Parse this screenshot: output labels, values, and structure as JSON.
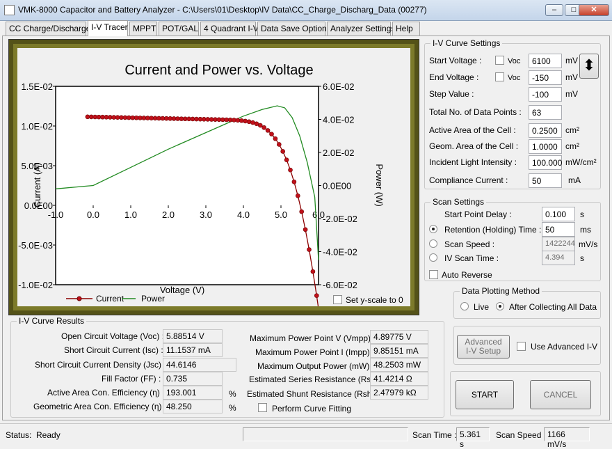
{
  "window": {
    "title": "VMK-8000 Capacitor and Battery Analyzer - C:\\Users\\01\\Desktop\\IV Data\\CC_Charge_Discharg_Data (00277)"
  },
  "tabs": [
    "CC Charge/Discharge",
    "I-V Tracer",
    "MPPT",
    "POT/GAL",
    "4 Quadrant I-V",
    "Data Save Options",
    "Analyzer Settings",
    "Help"
  ],
  "active_tab": "I-V Tracer",
  "chart_data": {
    "type": "line",
    "title": "Current and Power vs. Voltage",
    "xlabel": "Voltage (V)",
    "ylabel": "Current (A)",
    "y2label": "Power (W)",
    "xlim": [
      -1.0,
      6.0
    ],
    "ylim": [
      -0.01,
      0.015
    ],
    "y2lim": [
      -0.06,
      0.06
    ],
    "x_ticks": [
      "-1.0",
      "0.0",
      "1.0",
      "2.0",
      "3.0",
      "4.0",
      "5.0",
      "6.0"
    ],
    "y_ticks": [
      "1.5E-02",
      "1.0E-02",
      "5.0E-03",
      "0.0E00",
      "-5.0E-03",
      "-1.0E-02"
    ],
    "y2_ticks": [
      "6.0E-02",
      "4.0E-02",
      "2.0E-02",
      "0.0E00",
      "-2.0E-02",
      "-4.0E-02",
      "-6.0E-02"
    ],
    "series": [
      {
        "name": "Current",
        "color": "#8b0000",
        "marker_color": "#c0101a",
        "x": [
          -0.15,
          -0.05,
          0.05,
          0.15,
          0.25,
          0.35,
          0.45,
          0.55,
          0.65,
          0.75,
          0.85,
          0.95,
          1.05,
          1.15,
          1.25,
          1.35,
          1.45,
          1.55,
          1.65,
          1.75,
          1.85,
          1.95,
          2.05,
          2.15,
          2.25,
          2.35,
          2.45,
          2.55,
          2.65,
          2.75,
          2.85,
          2.95,
          3.05,
          3.15,
          3.25,
          3.35,
          3.45,
          3.55,
          3.65,
          3.75,
          3.85,
          3.95,
          4.05,
          4.15,
          4.25,
          4.35,
          4.45,
          4.55,
          4.65,
          4.75,
          4.85,
          4.95,
          5.05,
          5.15,
          5.25,
          5.35,
          5.45,
          5.55,
          5.65,
          5.75,
          5.85,
          5.95,
          6.05
        ],
        "y": [
          0.01116,
          0.01115,
          0.01114,
          0.01113,
          0.01112,
          0.01111,
          0.0111,
          0.01109,
          0.01108,
          0.01107,
          0.01106,
          0.01105,
          0.01104,
          0.01103,
          0.01102,
          0.01101,
          0.011,
          0.01099,
          0.01098,
          0.01097,
          0.01096,
          0.01095,
          0.01094,
          0.01093,
          0.01092,
          0.01091,
          0.0109,
          0.01089,
          0.01088,
          0.01087,
          0.01086,
          0.01085,
          0.01084,
          0.01083,
          0.01082,
          0.01081,
          0.0108,
          0.01079,
          0.01077,
          0.01075,
          0.01072,
          0.01068,
          0.01062,
          0.01054,
          0.01043,
          0.01028,
          0.01008,
          0.0098,
          0.00944,
          0.00898,
          0.0084,
          0.00768,
          0.0068,
          0.00573,
          0.00446,
          0.00296,
          0.00121,
          -0.00079,
          -0.00305,
          -0.00557,
          -0.00834,
          -0.01137,
          -0.01466
        ]
      },
      {
        "name": "Power",
        "color": "#228b22",
        "x": [
          -1.0,
          0.0,
          1.0,
          2.0,
          3.0,
          3.5,
          4.0,
          4.5,
          4.9,
          5.1,
          5.3,
          5.5,
          5.7,
          5.9,
          6.0
        ],
        "y": [
          -0.002,
          0.0,
          0.011,
          0.022,
          0.032,
          0.037,
          0.042,
          0.046,
          0.0482,
          0.047,
          0.041,
          0.03,
          0.014,
          -0.007,
          -0.045
        ]
      }
    ],
    "legend_position": "bottom-left",
    "grid": false
  },
  "chart_controls": {
    "set_y_scale_label": "Set y-scale to 0"
  },
  "iv_settings": {
    "title": "I-V Curve Settings",
    "start_voltage_label": "Start Voltage :",
    "start_voltage": "6100",
    "start_voltage_unit": "mV",
    "end_voltage_label": "End Voltage :",
    "end_voltage": "-150",
    "end_voltage_unit": "mV",
    "voc_label": "Voc",
    "step_label": "Step Value :",
    "step": "-100",
    "step_unit": "mV",
    "total_points_label": "Total No. of Data Points :",
    "total_points": "63",
    "active_area_label": "Active Area of the Cell :",
    "active_area": "0.2500",
    "area_unit": "cm²",
    "geom_area_label": "Geom. Area of the Cell :",
    "geom_area": "1.0000",
    "light_label": "Incident Light Intensity :",
    "light": "100.000",
    "light_unit": "mW/cm²",
    "compliance_label": "Compliance Current :",
    "compliance": "50",
    "compliance_unit": "mA"
  },
  "scan_settings": {
    "title": "Scan Settings",
    "start_delay_label": "Start Point Delay :",
    "start_delay": "0.100",
    "start_delay_unit": "s",
    "retention_label": "Retention (Holding) Time :",
    "retention": "50",
    "retention_unit": "ms",
    "scan_speed_label": "Scan Speed :",
    "scan_speed": "1422244",
    "scan_speed_unit": "mV/s",
    "scan_time_label": "IV Scan Time :",
    "scan_time": "4.394",
    "scan_time_unit": "s",
    "auto_reverse_label": "Auto Reverse"
  },
  "plotting": {
    "title": "Data Plotting Method",
    "live_label": "Live",
    "after_label": "After Collecting All Data"
  },
  "advanced": {
    "button_label_1": "Advanced",
    "button_label_2": "I-V Setup",
    "use_label": "Use Advanced I-V"
  },
  "actions": {
    "start": "START",
    "cancel": "CANCEL"
  },
  "results": {
    "title": "I-V Curve Results",
    "voc_label": "Open Circuit Voltage (Voc) :",
    "voc": "5.88514 V",
    "isc_label": "Short Circuit Current (Isc) :",
    "isc": "11.1537 mA",
    "jsc_label": "Short Circuit Current Density (Jsc) :",
    "jsc": "44.6146",
    "ff_label": "Fill Factor (FF) :",
    "ff": "0.735",
    "active_eff_label": "Active Area Con. Efficiency (η) :",
    "active_eff": "193.001",
    "geom_eff_label": "Geometric Area Con. Efficiency (η) :",
    "geom_eff": "48.250",
    "pct": "%",
    "vmpp_label": "Maximum Power Point V (Vmpp) :",
    "vmpp": "4.89775 V",
    "impp_label": "Maximum Power Point I (Impp) :",
    "impp": "9.85151 mA",
    "pmax_label": "Maximum Output Power (mW) :",
    "pmax": "48.2503 mW",
    "rs_label": "Estimated Series Resistance (Rs) :",
    "rs": "41.4214 Ω",
    "rsh_label": "Estimated Shunt Resistance (Rsh) :",
    "rsh": "2.47979 kΩ",
    "curve_fit_label": "Perform Curve Fitting"
  },
  "status": {
    "status_label": "Status:",
    "status": "Ready",
    "scan_time_label": "Scan Time :",
    "scan_time": "5.361 s",
    "scan_speed_label": "Scan Speed :",
    "scan_speed": "1166 mV/s"
  }
}
